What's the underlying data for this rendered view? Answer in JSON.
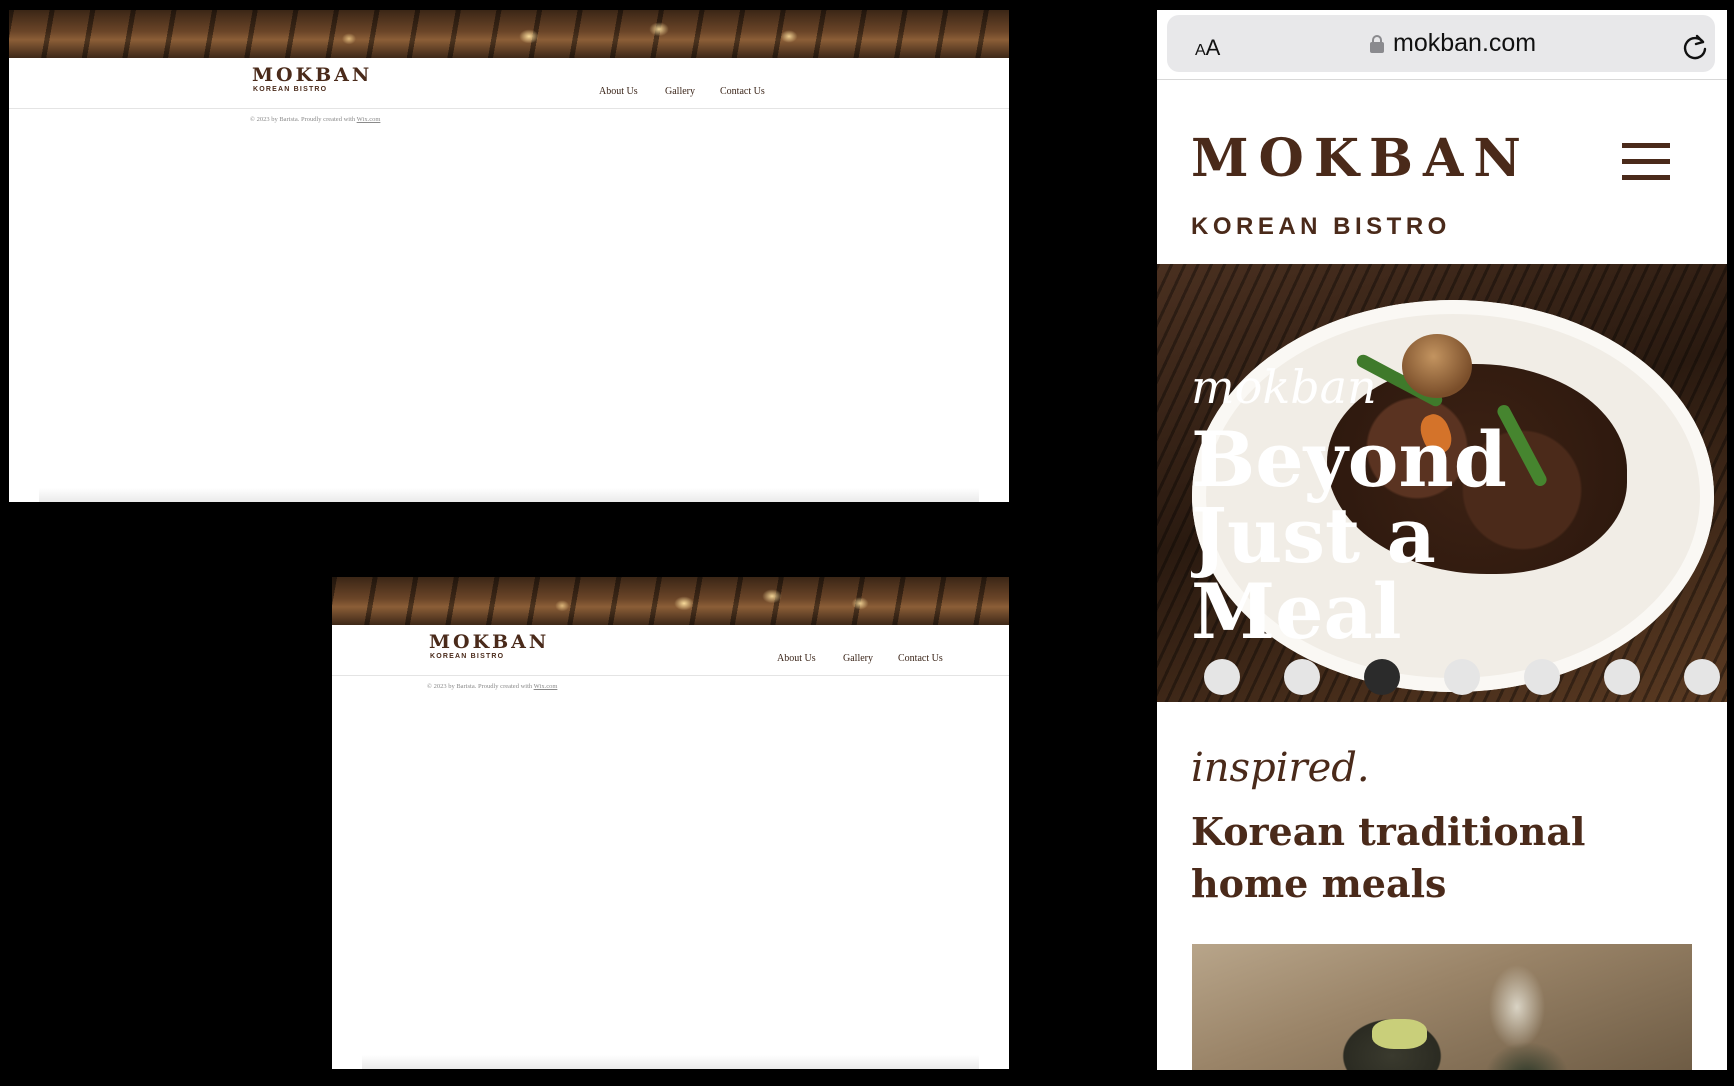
{
  "desktop": {
    "logo_title": "MOKBAN",
    "logo_subtitle": "KOREAN BISTRO",
    "nav": [
      {
        "label": "About Us"
      },
      {
        "label": "Gallery"
      },
      {
        "label": "Contact Us"
      }
    ],
    "footer_text": "© 2023 by Barista. Proudly created with ",
    "footer_link": "Wix.com"
  },
  "mobile": {
    "browser": {
      "text_size_label_small": "A",
      "text_size_label_large": "A",
      "url": "mokban.com",
      "lock_icon": "lock-icon",
      "reload_icon": "reload-icon"
    },
    "logo_title": "MOKBAN",
    "logo_subtitle": "KOREAN BISTRO",
    "menu_icon": "hamburger-menu-icon",
    "hero": {
      "script": "mokban",
      "title": "Beyond Just a Meal",
      "slide_count": 7,
      "active_slide": 3
    },
    "section": {
      "script": "inspired.",
      "title": "Korean traditional home meals"
    }
  },
  "colors": {
    "brand_brown": "#4a2a1a",
    "background": "#000000",
    "page": "#ffffff",
    "active_dot": "#2b2b2b",
    "inactive_dot": "#e5e5e5"
  }
}
